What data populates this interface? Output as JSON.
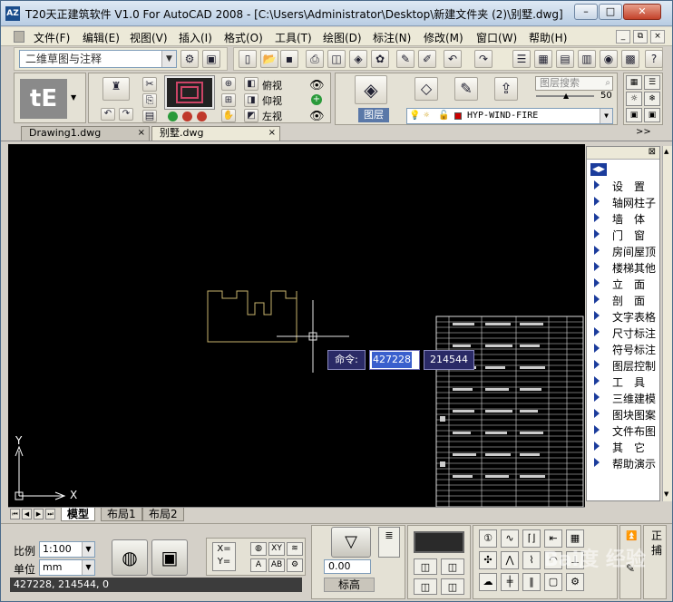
{
  "window": {
    "title": "T20天正建筑软件 V1.0 For AutoCAD 2008 - [C:\\Users\\Administrator\\Desktop\\新建文件夹 (2)\\别墅.dwg]",
    "icon_text": "AZ",
    "controls": {
      "min": "–",
      "max": "□",
      "close": "✕"
    }
  },
  "menu": {
    "items": [
      "文件(F)",
      "编辑(E)",
      "视图(V)",
      "插入(I)",
      "格式(O)",
      "工具(T)",
      "绘图(D)",
      "标注(N)",
      "修改(M)",
      "窗口(W)",
      "帮助(H)"
    ],
    "doc_controls": {
      "min": "_",
      "restore": "⧉",
      "close": "×"
    }
  },
  "toolbar": {
    "workspace_value": "二维草图与注释",
    "help": "?"
  },
  "view_panel": {
    "top": "俯视",
    "bottom": "仰视",
    "left": "左视"
  },
  "layer_panel": {
    "label": "图层",
    "search_placeholder": "图层搜索",
    "slider_value": "50",
    "current_layer": "HYP-WIND-FIRE"
  },
  "doc_tabs": [
    {
      "label": "Drawing1.dwg",
      "active": false
    },
    {
      "label": "别墅.dwg",
      "active": true
    }
  ],
  "command_input": {
    "label": "命令:",
    "x_value": "427228",
    "y_value": "214544"
  },
  "axis": {
    "x": "X",
    "y": "Y"
  },
  "side_panel": {
    "items": [
      "设　置",
      "轴网柱子",
      "墙　体",
      "门　窗",
      "房间屋顶",
      "楼梯其他",
      "立　面",
      "剖　面",
      "文字表格",
      "尺寸标注",
      "符号标注",
      "图层控制",
      "工　具",
      "三维建模",
      "图块图案",
      "文件布图",
      "其　它",
      "帮助演示"
    ]
  },
  "layout_tabs": [
    {
      "label": "模型",
      "active": true
    },
    {
      "label": "布局1",
      "active": false
    },
    {
      "label": "布局2",
      "active": false
    }
  ],
  "status": {
    "scale_label": "比例",
    "scale_value": "1:100",
    "unit_label": "单位",
    "unit_value": "mm",
    "coords": "427228, 214544, 0",
    "elevation_value": "0.00",
    "elevation_label": "标高",
    "right_top": "正",
    "right_bottom": "捕"
  },
  "watermark": "Bai度 经验"
}
